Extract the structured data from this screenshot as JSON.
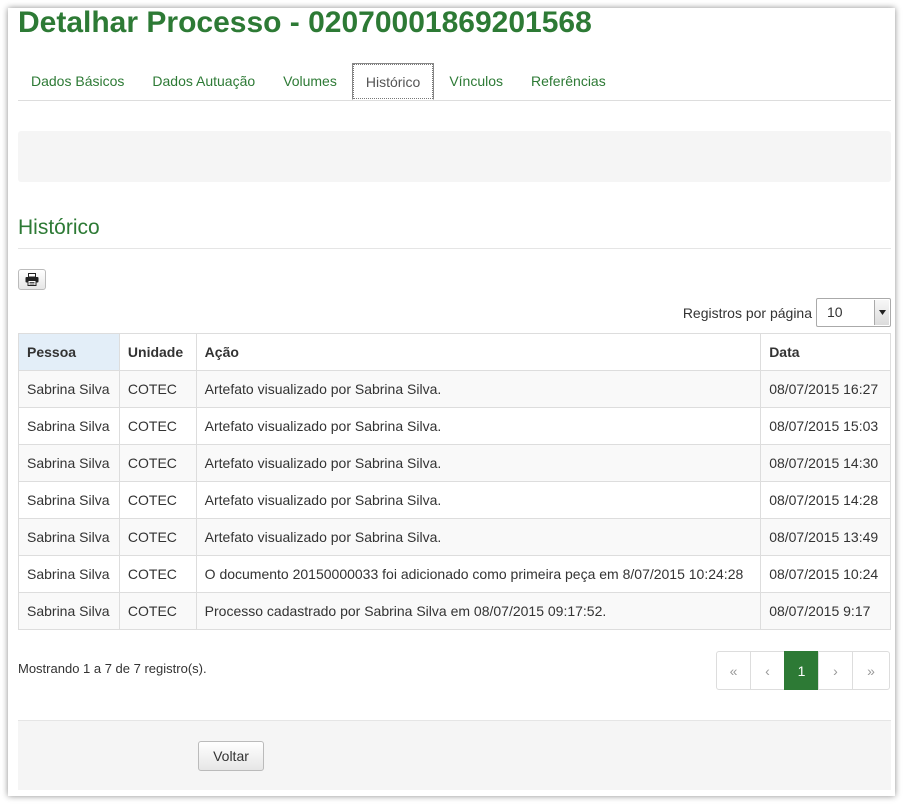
{
  "page": {
    "title": "Detalhar Processo - 02070001869201568"
  },
  "tabs": [
    {
      "label": "Dados Básicos"
    },
    {
      "label": "Dados Autuação"
    },
    {
      "label": "Volumes"
    },
    {
      "label": "Histórico",
      "active": true
    },
    {
      "label": "Vínculos"
    },
    {
      "label": "Referências"
    }
  ],
  "section": {
    "title": "Histórico"
  },
  "toolbar": {
    "print_icon": "printer-icon"
  },
  "perpage": {
    "label": "Registros por página",
    "value": "10"
  },
  "table": {
    "headers": [
      "Pessoa",
      "Unidade",
      "Ação",
      "Data"
    ],
    "rows": [
      [
        "Sabrina Silva",
        "COTEC",
        "Artefato visualizado por Sabrina Silva.",
        "08/07/2015 16:27"
      ],
      [
        "Sabrina Silva",
        "COTEC",
        "Artefato visualizado por Sabrina Silva.",
        "08/07/2015 15:03"
      ],
      [
        "Sabrina Silva",
        "COTEC",
        "Artefato visualizado por Sabrina Silva.",
        "08/07/2015 14:30"
      ],
      [
        "Sabrina Silva",
        "COTEC",
        "Artefato visualizado por Sabrina Silva.",
        "08/07/2015 14:28"
      ],
      [
        "Sabrina Silva",
        "COTEC",
        "Artefato visualizado por Sabrina Silva.",
        "08/07/2015 13:49"
      ],
      [
        "Sabrina Silva",
        "COTEC",
        "O documento 20150000033 foi adicionado como primeira peça em 8/07/2015 10:24:28",
        "08/07/2015 10:24"
      ],
      [
        "Sabrina Silva",
        "COTEC",
        "Processo cadastrado por Sabrina Silva em 08/07/2015 09:17:52.",
        "08/07/2015 9:17"
      ]
    ]
  },
  "summary": {
    "text": "Mostrando 1 a 7 de 7 registro(s)."
  },
  "pagination": {
    "first": "«",
    "prev": "‹",
    "current": "1",
    "next": "›",
    "last": "»"
  },
  "footer": {
    "back_label": "Voltar"
  },
  "colors": {
    "accent": "#2d7a35"
  }
}
